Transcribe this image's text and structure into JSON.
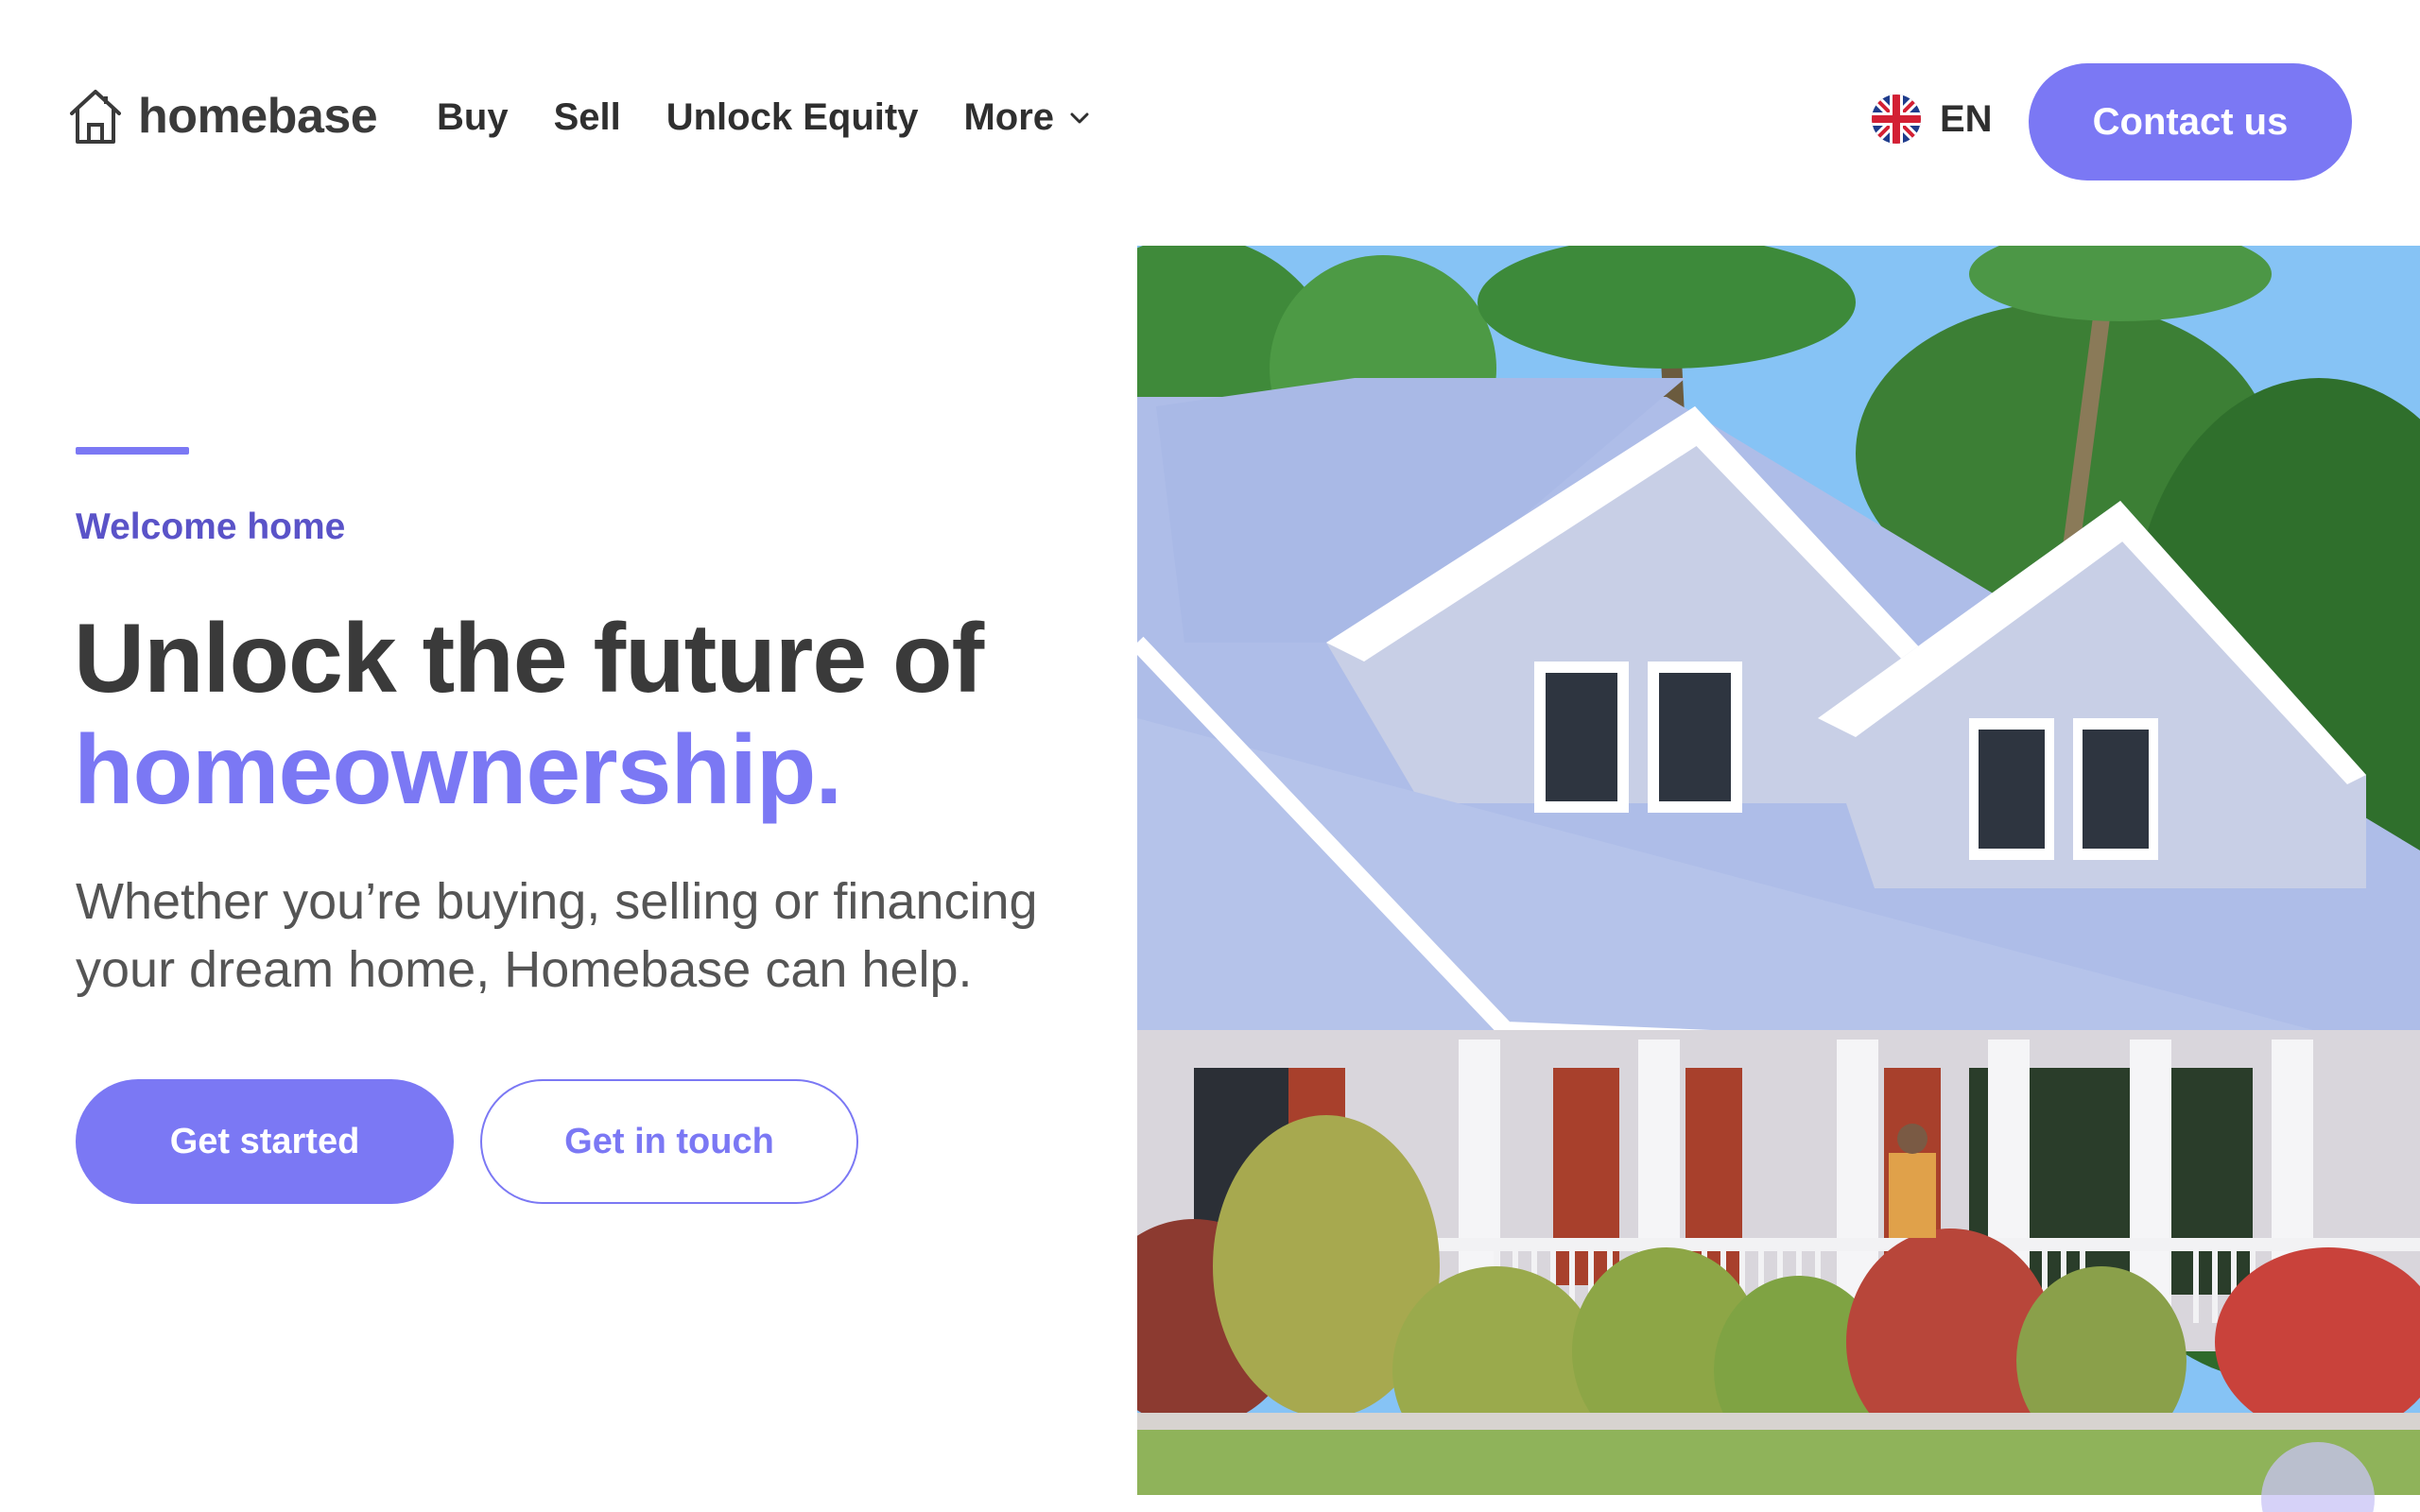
{
  "brand": {
    "name": "homebase",
    "icon": "house-icon"
  },
  "nav": {
    "items": [
      {
        "label": "Buy"
      },
      {
        "label": "Sell"
      },
      {
        "label": "Unlock Equity"
      },
      {
        "label": "More",
        "icon": "chevron-down-icon"
      }
    ]
  },
  "language": {
    "code": "EN",
    "icon": "uk-flag-icon"
  },
  "contact_label": "Contact us",
  "hero": {
    "eyebrow": "Welcome home",
    "headline_line1": "Unlock the future of",
    "headline_line2": "homeownership.",
    "subhead": "Whether you’re buying, selling or financing your dream home, Homebase can help.",
    "primary_cta": "Get started",
    "secondary_cta": "Get in touch"
  },
  "colors": {
    "accent": "#7b78f4",
    "eyebrow": "#5a53c8",
    "heading": "#3a3a3a",
    "body": "#555555"
  }
}
